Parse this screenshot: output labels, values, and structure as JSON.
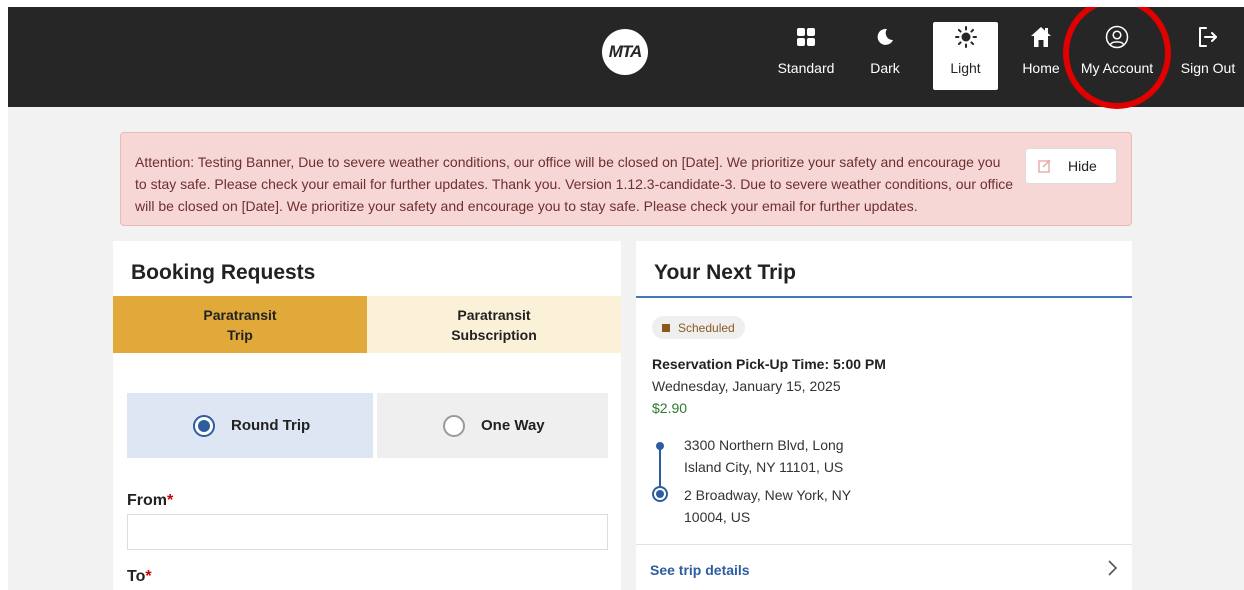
{
  "header": {
    "logo_text": "MTA",
    "nav": {
      "standard": "Standard",
      "dark": "Dark",
      "light": "Light",
      "home": "Home",
      "my_account": "My Account",
      "sign_out": "Sign Out"
    },
    "active_theme": "Light",
    "icons": [
      "grid-icon",
      "moon-icon",
      "sun-icon",
      "home-icon",
      "user-circle-icon",
      "sign-out-icon"
    ]
  },
  "banner": {
    "text": "Attention: Testing Banner, Due to severe weather conditions, our office will be closed on [Date]. We prioritize your safety and encourage you to stay safe. Please check your email for further updates. Thank you. Version 1.12.3-candidate-3. Due to severe weather conditions, our office will be closed on [Date]. We prioritize your safety and encourage you to stay safe. Please check your email for further updates.",
    "hide_label": "Hide"
  },
  "booking": {
    "title": "Booking Requests",
    "tabs": [
      {
        "line1": "Paratransit",
        "line2": "Trip",
        "active": true
      },
      {
        "line1": "Paratransit",
        "line2": "Subscription",
        "active": false
      }
    ],
    "trip_type": {
      "round_trip": "Round Trip",
      "one_way": "One Way",
      "selected": "Round Trip"
    },
    "from_label": "From",
    "from_value": "",
    "to_label": "To",
    "required_mark": "*"
  },
  "next_trip": {
    "title": "Your Next Trip",
    "status": "Scheduled",
    "pickup": "Reservation Pick-Up Time: 5:00 PM",
    "date": "Wednesday, January 15, 2025",
    "fare": "$2.90",
    "from_address": "3300 Northern Blvd, Long Island City, NY 11101, US",
    "to_address": "2 Broadway, New York, NY 10004, US",
    "details_link": "See trip details"
  },
  "colors": {
    "header_bg": "#262626",
    "banner_bg": "#f6d7d6",
    "active_tab": "#e0a93a",
    "inactive_tab": "#fbf0d8",
    "link": "#2d5da1",
    "fare": "#2c7a2c",
    "highlight": "#e00000"
  }
}
